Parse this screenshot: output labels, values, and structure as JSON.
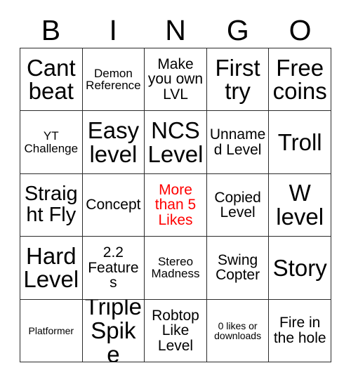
{
  "card": {
    "title": "BINGO",
    "header_letters": [
      "B",
      "I",
      "N",
      "G",
      "O"
    ],
    "grid_size": "5x5",
    "marked_color": "#ff0000",
    "text_color": "#000000",
    "background_color": "#ffffff",
    "border_color": "#2b2b2b",
    "cells": [
      {
        "text": "Cant beat",
        "size": "xl",
        "marked": false
      },
      {
        "text": "Demon Reference",
        "size": "sm",
        "marked": false
      },
      {
        "text": "Make you own LVL",
        "size": "md",
        "marked": false
      },
      {
        "text": "First try",
        "size": "xl",
        "marked": false
      },
      {
        "text": "Free coins",
        "size": "xl",
        "marked": false
      },
      {
        "text": "YT Challenge",
        "size": "sm",
        "marked": false
      },
      {
        "text": "Easy level",
        "size": "xl",
        "marked": false
      },
      {
        "text": "NCS Level",
        "size": "xl",
        "marked": false
      },
      {
        "text": "Unnamed Level",
        "size": "md",
        "marked": false
      },
      {
        "text": "Troll",
        "size": "xl",
        "marked": false
      },
      {
        "text": "Straight Fly",
        "size": "lg",
        "marked": false
      },
      {
        "text": "Concept",
        "size": "md",
        "marked": false
      },
      {
        "text": "More than 5 Likes",
        "size": "md",
        "marked": true
      },
      {
        "text": "Copied Level",
        "size": "md",
        "marked": false
      },
      {
        "text": "W level",
        "size": "xl",
        "marked": false
      },
      {
        "text": "Hard Level",
        "size": "xl",
        "marked": false
      },
      {
        "text": "2.2 Features",
        "size": "md",
        "marked": false
      },
      {
        "text": "Stereo Madness",
        "size": "sm",
        "marked": false
      },
      {
        "text": "Swing Copter",
        "size": "md",
        "marked": false
      },
      {
        "text": "Story",
        "size": "xl",
        "marked": false
      },
      {
        "text": "Platformer",
        "size": "xs",
        "marked": false
      },
      {
        "text": "Triple Spike",
        "size": "xl",
        "marked": false
      },
      {
        "text": "Robtop Like Level",
        "size": "md",
        "marked": false
      },
      {
        "text": "0 likes or downloads",
        "size": "xs",
        "marked": false
      },
      {
        "text": "Fire in the hole",
        "size": "md",
        "marked": false
      }
    ]
  }
}
